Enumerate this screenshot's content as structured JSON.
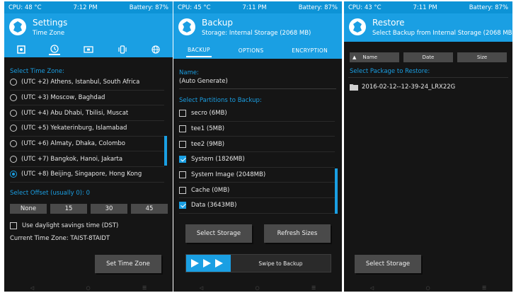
{
  "panels": [
    {
      "status": {
        "cpu": "CPU: 48 °C",
        "time": "7:12 PM",
        "battery": "Battery: 87%"
      },
      "title": "Settings",
      "subtitle": "Time Zone",
      "tab_icons": [
        "settings-icon",
        "clock-icon",
        "screen-icon",
        "vibrate-icon",
        "globe-icon"
      ],
      "select_label": "Select Time Zone:",
      "zones": [
        {
          "label": "(UTC +2) Athens, Istanbul, South Africa",
          "selected": false
        },
        {
          "label": "(UTC +3) Moscow, Baghdad",
          "selected": false
        },
        {
          "label": "(UTC +4) Abu Dhabi, Tbilisi, Muscat",
          "selected": false
        },
        {
          "label": "(UTC +5) Yekaterinburg, Islamabad",
          "selected": false
        },
        {
          "label": "(UTC +6) Almaty, Dhaka, Colombo",
          "selected": false
        },
        {
          "label": "(UTC +7) Bangkok, Hanoi, Jakarta",
          "selected": false
        },
        {
          "label": "(UTC +8) Beijing, Singapore, Hong Kong",
          "selected": true
        }
      ],
      "offset_label": "Select Offset (usually 0): 0",
      "offsets": [
        "None",
        "15",
        "30",
        "45"
      ],
      "dst_label": "Use daylight savings time (DST)",
      "current_tz": "Current Time Zone: TAIST-8TAIDT",
      "set_button": "Set Time Zone"
    },
    {
      "status": {
        "cpu": "CPU: 45 °C",
        "time": "7:11 PM",
        "battery": "Battery: 87%"
      },
      "title": "Backup",
      "subtitle": "Storage: Internal Storage (2068 MB)",
      "tabs": [
        "BACKUP",
        "OPTIONS",
        "ENCRYPTION"
      ],
      "name_label": "Name:",
      "name_value": "(Auto Generate)",
      "partitions_label": "Select Partitions to Backup:",
      "partitions": [
        {
          "label": "secro (6MB)",
          "checked": false
        },
        {
          "label": "tee1 (5MB)",
          "checked": false
        },
        {
          "label": "tee2 (9MB)",
          "checked": false
        },
        {
          "label": "System (1826MB)",
          "checked": true
        },
        {
          "label": "System Image (2048MB)",
          "checked": false
        },
        {
          "label": "Cache (0MB)",
          "checked": false
        },
        {
          "label": "Data (3643MB)",
          "checked": true
        }
      ],
      "select_storage": "Select Storage",
      "refresh_sizes": "Refresh Sizes",
      "swipe_label": "Swipe to Backup"
    },
    {
      "status": {
        "cpu": "CPU: 43 °C",
        "time": "7:11 PM",
        "battery": "Battery: 87%"
      },
      "title": "Restore",
      "subtitle": "Select Backup from Internal Storage (2068 MB)",
      "sort": {
        "name": "Name",
        "date": "Date",
        "size": "Size"
      },
      "package_label": "Select Package to Restore:",
      "packages": [
        "2016-02-12--12-39-24_LRX22G"
      ],
      "select_storage": "Select Storage"
    }
  ],
  "colors": {
    "accent": "#1a9fe3",
    "status": "#0d93d6",
    "background": "#151515",
    "button": "#4a4a4a"
  },
  "nav_icons": [
    "back-icon",
    "home-icon",
    "menu-icon"
  ]
}
